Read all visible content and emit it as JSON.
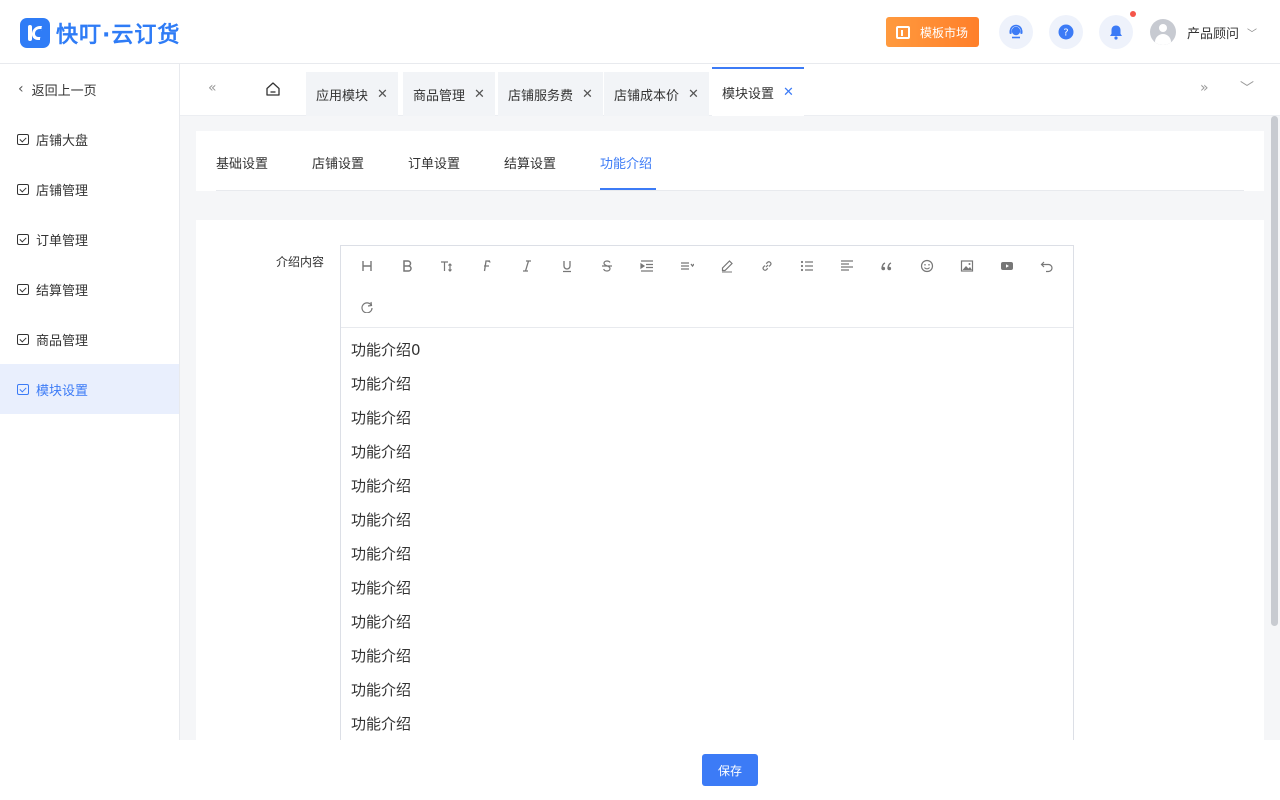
{
  "header": {
    "logo_text": "快叮·云订货",
    "market_label": "模板市场",
    "user_name": "产品顾问",
    "icons": [
      "service-icon",
      "help-icon",
      "bell-icon"
    ],
    "accent_color": "#3c7bf6"
  },
  "sidebar": {
    "back_label": "返回上一页",
    "items": [
      {
        "label": "店铺大盘",
        "active": false
      },
      {
        "label": "店铺管理",
        "active": false
      },
      {
        "label": "订单管理",
        "active": false
      },
      {
        "label": "结算管理",
        "active": false
      },
      {
        "label": "商品管理",
        "active": false
      },
      {
        "label": "模块设置",
        "active": true
      }
    ]
  },
  "tabs": [
    {
      "label": "应用模块",
      "active": false
    },
    {
      "label": "商品管理",
      "active": false
    },
    {
      "label": "店铺服务费",
      "active": false
    },
    {
      "label": "店铺成本价",
      "active": false
    },
    {
      "label": "模块设置",
      "active": true
    }
  ],
  "subtabs": [
    {
      "label": "基础设置",
      "active": false
    },
    {
      "label": "店铺设置",
      "active": false
    },
    {
      "label": "订单设置",
      "active": false
    },
    {
      "label": "结算设置",
      "active": false
    },
    {
      "label": "功能介绍",
      "active": true
    }
  ],
  "form": {
    "label": "介绍内容",
    "toolbar_icons": [
      "heading",
      "bold",
      "font-size",
      "font-family",
      "italic",
      "underline",
      "strikethrough",
      "indent",
      "line-height",
      "pen",
      "link",
      "list",
      "align",
      "quote",
      "emoji",
      "image",
      "video",
      "undo",
      "redo"
    ],
    "content_lines": [
      "功能介绍0",
      "功能介绍",
      "功能介绍",
      "功能介绍",
      "功能介绍",
      "功能介绍",
      "功能介绍",
      "功能介绍",
      "功能介绍",
      "功能介绍",
      "功能介绍",
      "功能介绍"
    ]
  },
  "footer": {
    "save_label": "保存"
  }
}
